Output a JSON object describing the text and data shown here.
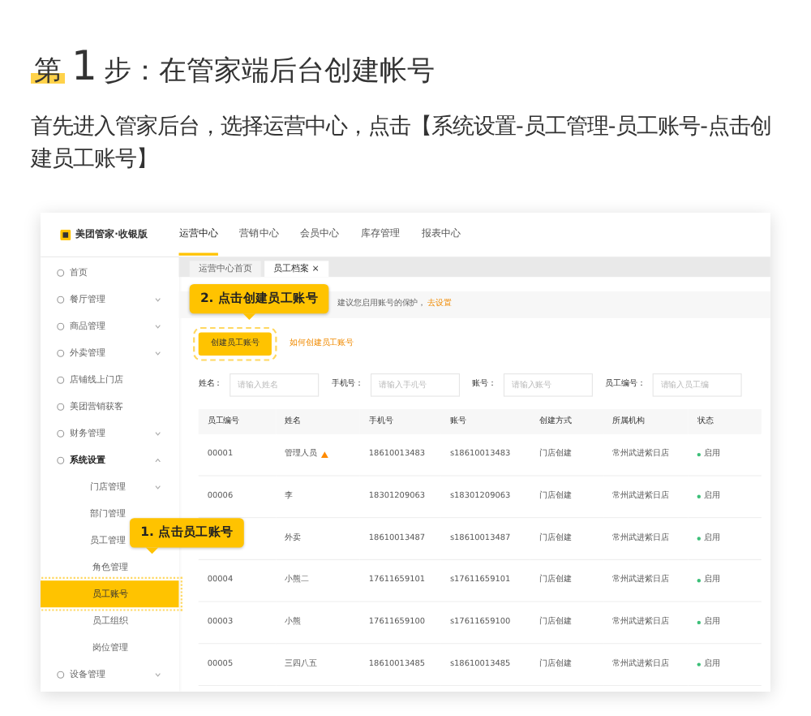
{
  "heading": {
    "prefix": "第",
    "number": "1",
    "rest": "步：在管家端后台创建帐号"
  },
  "intro": "首先进入管家后台，选择运营中心，点击【系统设置-员工管理-员工账号-点击创建员工账号】",
  "app": {
    "logo": "美团管家·收银版",
    "nav": [
      {
        "label": "运营中心",
        "selected": true
      },
      {
        "label": "营销中心",
        "selected": false
      },
      {
        "label": "会员中心",
        "selected": false
      },
      {
        "label": "库存管理",
        "selected": false
      },
      {
        "label": "报表中心",
        "selected": false
      }
    ],
    "sidebar": [
      {
        "label": "首页",
        "selected": false
      },
      {
        "label": "餐厅管理",
        "expanded": false,
        "selected": false
      },
      {
        "label": "商品管理",
        "expanded": false,
        "selected": false
      },
      {
        "label": "外卖管理",
        "expanded": false,
        "selected": false
      },
      {
        "label": "店铺线上门店",
        "selected": false
      },
      {
        "label": "美团营销获客",
        "selected": false
      },
      {
        "label": "财务管理",
        "expanded": false,
        "selected": false
      },
      {
        "label": "系统设置",
        "expanded": true,
        "selected": false,
        "children": [
          {
            "label": "门店管理",
            "expanded": false,
            "selected": false
          },
          {
            "label": "部门管理",
            "selected": false
          },
          {
            "label": "员工管理",
            "selected": false,
            "children": [
              {
                "label": "角色管理",
                "selected": false
              },
              {
                "label": "员工账号",
                "selected": true
              },
              {
                "label": "员工组织",
                "selected": false
              },
              {
                "label": "岗位管理",
                "selected": false
              }
            ]
          }
        ]
      },
      {
        "label": "设备管理",
        "expanded": false,
        "selected": false
      }
    ],
    "tabs": [
      {
        "label": "运营中心首页",
        "selected": false
      },
      {
        "label": "员工档案",
        "close": "×",
        "selected": true
      }
    ],
    "notice": {
      "text": "建议您启用账号的保护，",
      "link": "去设置"
    },
    "create_button": "创建员工账号",
    "help_link": "如何创建员工账号",
    "filters": [
      {
        "label": "姓名：",
        "placeholder": "请输入姓名"
      },
      {
        "label": "手机号：",
        "placeholder": "请输入手机号"
      },
      {
        "label": "账号：",
        "placeholder": "请输入账号"
      },
      {
        "label": "员工编号：",
        "placeholder": "请输入员工编"
      }
    ],
    "table": {
      "columns": [
        "员工编号",
        "姓名",
        "手机号",
        "账号",
        "创建方式",
        "所属机构",
        "状态"
      ],
      "rows": [
        {
          "cells": [
            "00001",
            "管理人员",
            "18610013483",
            "s18610013483",
            "门店创建",
            "常州武进紫日店",
            "启用"
          ],
          "warning": true
        },
        {
          "cells": [
            "00006",
            "李",
            "18301209063",
            "s18301209063",
            "门店创建",
            "常州武进紫日店",
            "启用"
          ],
          "warning": false
        },
        {
          "cells": [
            "",
            "外卖",
            "18610013487",
            "s18610013487",
            "门店创建",
            "常州武进紫日店",
            "启用"
          ],
          "warning": false
        },
        {
          "cells": [
            "00004",
            "小熊二",
            "17611659101",
            "s17611659101",
            "门店创建",
            "常州武进紫日店",
            "启用"
          ],
          "warning": false
        },
        {
          "cells": [
            "00003",
            "小熊",
            "17611659100",
            "s17611659100",
            "门店创建",
            "常州武进紫日店",
            "启用"
          ],
          "warning": false
        },
        {
          "cells": [
            "00005",
            "三四八五",
            "18610013485",
            "s18610013485",
            "门店创建",
            "常州武进紫日店",
            "启用"
          ],
          "warning": false
        }
      ]
    },
    "callouts": [
      {
        "text": "1. 点击员工账号"
      },
      {
        "text": "2. 点击创建员工账号"
      }
    ]
  }
}
